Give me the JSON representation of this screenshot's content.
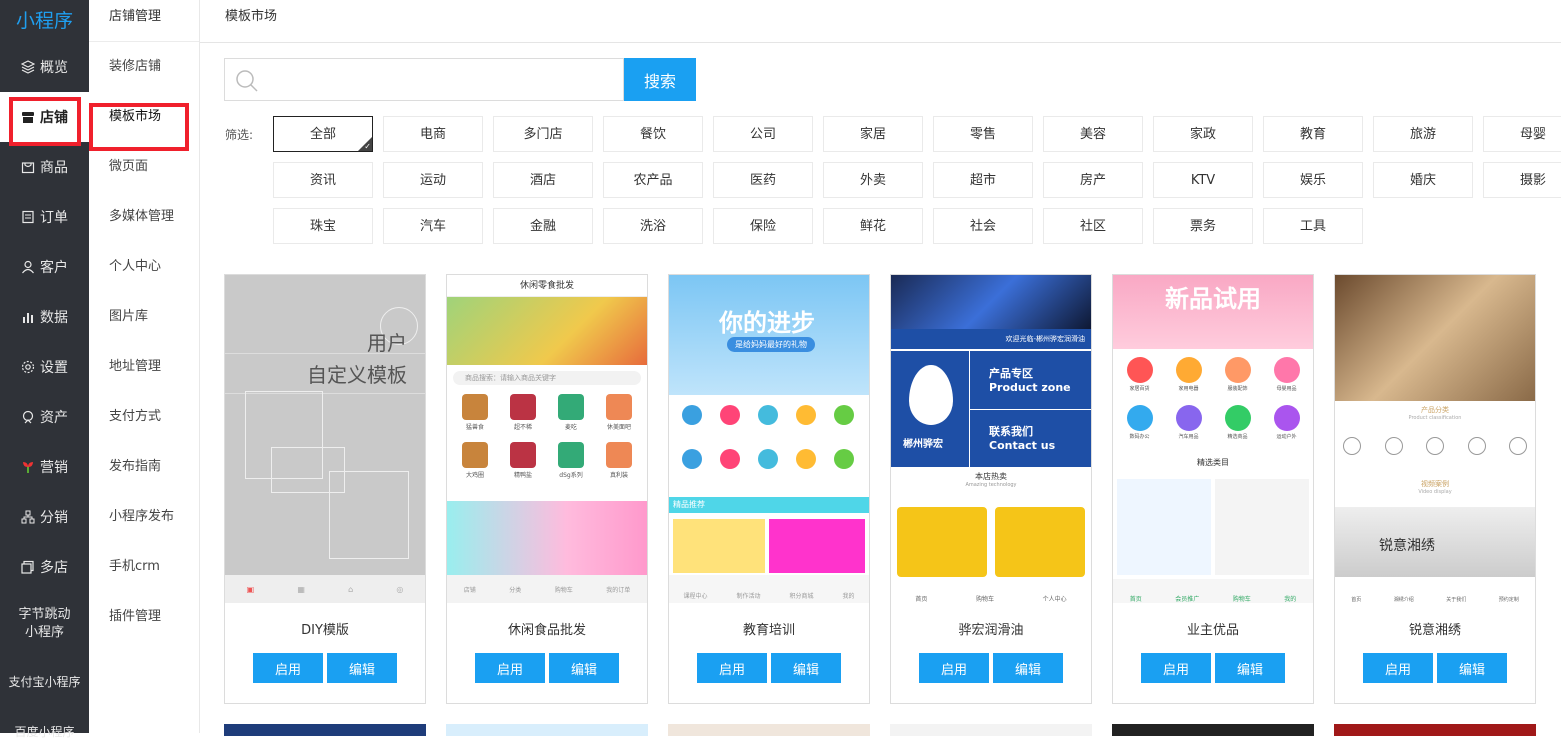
{
  "app": {
    "logo": "小程序"
  },
  "sidebar": {
    "items": [
      {
        "label": "概览",
        "icon": "layers-icon"
      },
      {
        "label": "店铺",
        "icon": "store-icon",
        "active": true
      },
      {
        "label": "商品",
        "icon": "goods-icon"
      },
      {
        "label": "订单",
        "icon": "order-icon"
      },
      {
        "label": "客户",
        "icon": "user-icon"
      },
      {
        "label": "数据",
        "icon": "chart-icon"
      },
      {
        "label": "设置",
        "icon": "gear-icon"
      },
      {
        "label": "资产",
        "icon": "asset-icon"
      },
      {
        "label": "营销",
        "icon": "marketing-icon"
      },
      {
        "label": "分销",
        "icon": "distribution-icon"
      },
      {
        "label": "多店",
        "icon": "multistore-icon"
      }
    ],
    "bytedance": {
      "line1": "字节跳动",
      "line2": "小程序"
    },
    "alipay": "支付宝小程序",
    "baidu": "百度小程序"
  },
  "subnav": {
    "title": "店铺管理",
    "items": [
      "装修店铺",
      "模板市场",
      "微页面",
      "多媒体管理",
      "个人中心",
      "图片库",
      "地址管理",
      "支付方式",
      "发布指南",
      "小程序发布",
      "手机crm",
      "插件管理"
    ],
    "active_index": 1
  },
  "page": {
    "breadcrumb": "模板市场"
  },
  "search": {
    "placeholder": "",
    "value": "",
    "button": "搜索"
  },
  "filter": {
    "label": "筛选:",
    "tags": [
      "全部",
      "电商",
      "多门店",
      "餐饮",
      "公司",
      "家居",
      "零售",
      "美容",
      "家政",
      "教育",
      "旅游",
      "母婴",
      "资讯",
      "运动",
      "酒店",
      "农产品",
      "医药",
      "外卖",
      "超市",
      "房产",
      "KTV",
      "娱乐",
      "婚庆",
      "摄影",
      "珠宝",
      "汽车",
      "金融",
      "洗浴",
      "保险",
      "鲜花",
      "社会",
      "社区",
      "票务",
      "工具"
    ],
    "selected": "全部"
  },
  "templates": [
    {
      "name": "DIY模版",
      "enable": "启用",
      "edit": "编辑",
      "thumb": {
        "title1": "用户",
        "title2": "自定义模板"
      }
    },
    {
      "name": "休闲食品批发",
      "enable": "启用",
      "edit": "编辑",
      "thumb": {
        "header": "休闲零食批发",
        "search": "商品搜索：请输入商品关键字",
        "search_btn": "搜索",
        "cats": [
          "猛兽食",
          "超不稀",
          "麦吃",
          "休美面吧",
          "大鸡圈",
          "精鸭盐",
          "dSg系列",
          "真利装"
        ],
        "tabs": [
          "店铺",
          "分类",
          "购物车",
          "我的订单"
        ]
      }
    },
    {
      "name": "教育培训",
      "enable": "启用",
      "edit": "编辑",
      "thumb": {
        "banner": "你的进步",
        "banner_sub": "是给妈妈最好的礼物",
        "section": "精品推荐",
        "tabs": [
          "课程中心",
          "制作活动",
          "积分商城",
          "我的"
        ]
      }
    },
    {
      "name": "骅宏润滑油",
      "enable": "启用",
      "edit": "编辑",
      "thumb": {
        "welcome": "欢迎光临-郴州骅宏润滑油",
        "brand": "郴州骅宏",
        "zone_cn": "产品专区",
        "zone_en": "Product zone",
        "contact_cn": "联系我们",
        "contact_en": "Contact us",
        "hot": "本店热卖",
        "hot_en": "Amazing technology",
        "tabs": [
          "首页",
          "购物车",
          "个人中心"
        ]
      }
    },
    {
      "name": "业主优品",
      "enable": "启用",
      "edit": "编辑",
      "thumb": {
        "banner": "新品试用",
        "cats": [
          "家居百货",
          "家用电器",
          "服装配饰",
          "母婴用品",
          "数码办公",
          "汽车用品",
          "精选商品",
          "运动户外"
        ],
        "section": "精选类目",
        "tabs": [
          "首页",
          "会员推广",
          "购物车",
          "我的"
        ]
      }
    },
    {
      "name": "锐意湘绣",
      "enable": "启用",
      "edit": "编辑",
      "thumb": {
        "cat_title": "产品分类",
        "cat_en": "Product classification",
        "video": "视频案例",
        "video_en": "Video display",
        "brand": "锐意湘绣",
        "tabs": [
          "首页",
          "湘绣介绍",
          "关于我们",
          "预约定制"
        ]
      }
    }
  ],
  "colors": {
    "accent": "#1aa0f2",
    "sidebar_bg": "#2f3238",
    "highlight": "#f0202c"
  }
}
